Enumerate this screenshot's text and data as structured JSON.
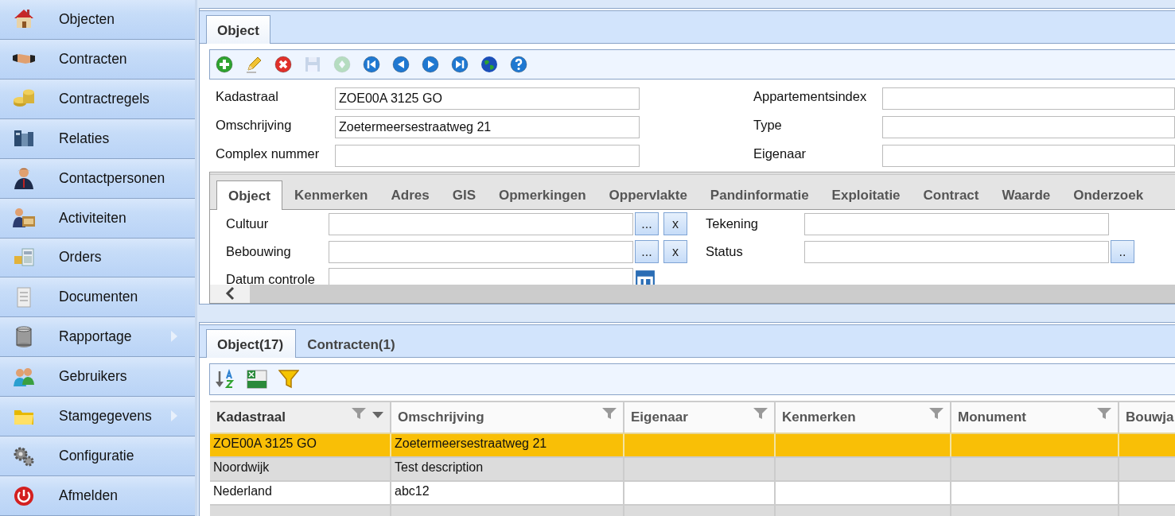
{
  "sidebar": {
    "items": [
      {
        "label": "Objecten",
        "submenu": false
      },
      {
        "label": "Contracten",
        "submenu": false
      },
      {
        "label": "Contractregels",
        "submenu": false
      },
      {
        "label": "Relaties",
        "submenu": false
      },
      {
        "label": "Contactpersonen",
        "submenu": false
      },
      {
        "label": "Activiteiten",
        "submenu": false
      },
      {
        "label": "Orders",
        "submenu": false
      },
      {
        "label": "Documenten",
        "submenu": false
      },
      {
        "label": "Rapportage",
        "submenu": true
      },
      {
        "label": "Gebruikers",
        "submenu": false
      },
      {
        "label": "Stamgegevens",
        "submenu": true
      },
      {
        "label": "Configuratie",
        "submenu": false
      },
      {
        "label": "Afmelden",
        "submenu": false
      }
    ]
  },
  "detail": {
    "tabs": [
      {
        "label": "Object",
        "selected": true
      }
    ],
    "toolbar": [
      {
        "disabled": false
      },
      {
        "disabled": false
      },
      {
        "disabled": false
      },
      {
        "disabled": true
      },
      {
        "disabled": true
      },
      {
        "disabled": false
      },
      {
        "disabled": false
      },
      {
        "disabled": false
      },
      {
        "disabled": false
      },
      {
        "disabled": false
      },
      {
        "disabled": false
      }
    ],
    "fields_left": [
      {
        "label": "Kadastraal",
        "value": "ZOE00A 3125 GO"
      },
      {
        "label": "Omschrijving",
        "value": "Zoetermeersestraatweg 21"
      },
      {
        "label": "Complex nummer"
      }
    ],
    "fields_right": [
      {
        "label": "Appartementsindex"
      },
      {
        "label": "Type"
      },
      {
        "label": "Eigenaar"
      }
    ],
    "subtabs": [
      {
        "label": "Object",
        "selected": true
      },
      {
        "label": "Kenmerken",
        "selected": false
      },
      {
        "label": "Adres",
        "selected": false
      },
      {
        "label": "GIS",
        "selected": false
      },
      {
        "label": "Opmerkingen",
        "selected": false
      },
      {
        "label": "Oppervlakte",
        "selected": false
      },
      {
        "label": "Pandinformatie",
        "selected": false
      },
      {
        "label": "Exploitatie",
        "selected": false
      },
      {
        "label": "Contract",
        "selected": false
      },
      {
        "label": "Waarde",
        "selected": false
      },
      {
        "label": "Onderzoek",
        "selected": false
      }
    ],
    "subfields_left": [
      {
        "label": "Cultuur",
        "kind": "lookup",
        "buttons": [
          "...",
          "x"
        ]
      },
      {
        "label": "Bebouwing",
        "kind": "lookup",
        "buttons": [
          "...",
          "x"
        ]
      },
      {
        "label": "Datum controle",
        "kind": "date"
      }
    ],
    "subfields_right": [
      {
        "label": "Tekening",
        "kind": "text"
      },
      {
        "label": "Status",
        "kind": "lookup",
        "buttons": [
          ".."
        ]
      }
    ]
  },
  "list": {
    "tabs": [
      {
        "label": "Object(17)",
        "selected": true
      },
      {
        "label": "Contracten(1)",
        "selected": false
      }
    ],
    "columns": [
      {
        "label": "Kadastraal",
        "sorted": true
      },
      {
        "label": "Omschrijving",
        "sorted": false
      },
      {
        "label": "Eigenaar",
        "sorted": false
      },
      {
        "label": "Kenmerken",
        "sorted": false
      },
      {
        "label": "Monument",
        "sorted": false
      },
      {
        "label": "Bouwja",
        "sorted": false
      }
    ],
    "rows": [
      {
        "cells": [
          "ZOE00A 3125 GO",
          "Zoetermeersestraatweg 21"
        ],
        "selected": true
      },
      {
        "cells": [
          "Noordwijk",
          "Test description"
        ],
        "selected": false
      },
      {
        "cells": [
          "Nederland",
          "abc12"
        ],
        "selected": false
      }
    ]
  }
}
